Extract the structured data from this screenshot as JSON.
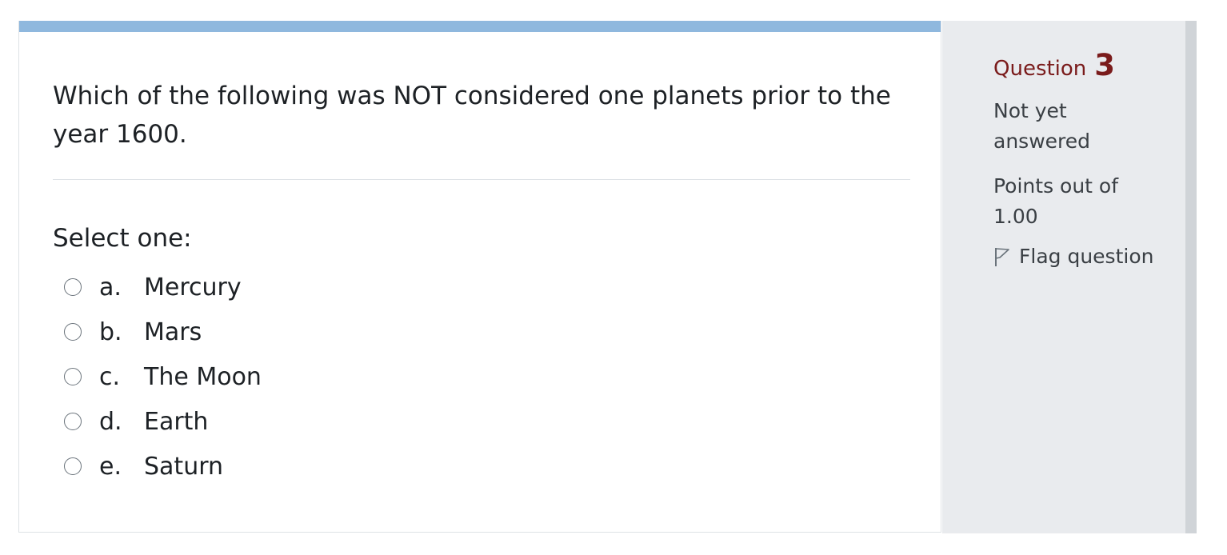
{
  "question": {
    "text": "Which of the following was NOT considered one planets prior to the year 1600.",
    "prompt": "Select one:",
    "answers": [
      {
        "letter": "a.",
        "text": "Mercury"
      },
      {
        "letter": "b.",
        "text": "Mars"
      },
      {
        "letter": "c.",
        "text": "The Moon"
      },
      {
        "letter": "d.",
        "text": "Earth"
      },
      {
        "letter": "e.",
        "text": "Saturn"
      }
    ]
  },
  "info": {
    "question_label": "Question",
    "question_number": "3",
    "state": "Not yet answered",
    "grade": "Points out of 1.00",
    "flag_label": "Flag question"
  },
  "colors": {
    "top_bar": "#8fb8de",
    "question_number": "#7a1b1b",
    "info_background": "#e9ebee"
  },
  "icons": {
    "flag": "flag-outline-icon",
    "radio": "radio-unselected-icon"
  }
}
